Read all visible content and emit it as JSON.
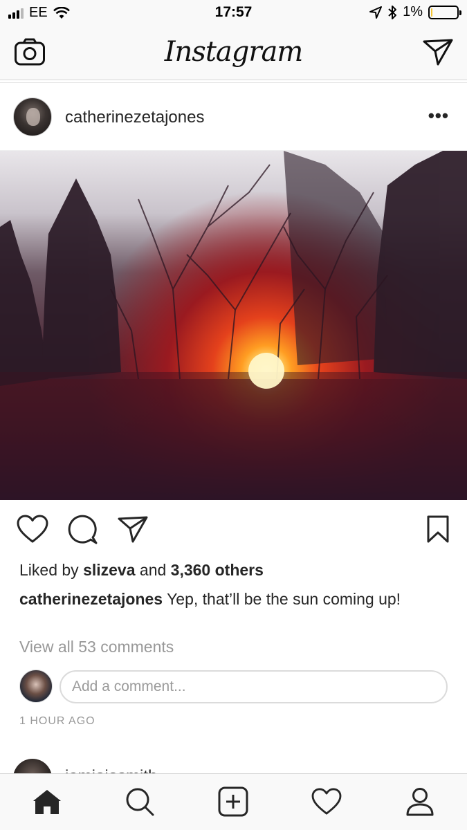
{
  "status_bar": {
    "carrier": "EE",
    "time": "17:57",
    "battery_percent": "1%",
    "battery_level": 0.05,
    "signal_bars_active": 3,
    "signal_bars_total": 4,
    "icons": [
      "wifi-icon",
      "location-arrow-icon",
      "bluetooth-icon",
      "battery-icon"
    ]
  },
  "header": {
    "logo": "Instagram",
    "left_icon": "camera-icon",
    "right_icon": "direct-message-icon"
  },
  "post": {
    "username": "catherinezetajones",
    "more_label": "•••",
    "image_description": "sunset",
    "actions": [
      "heart-icon",
      "comment-icon",
      "share-icon",
      "bookmark-icon"
    ],
    "likes_prefix": "Liked by",
    "liked_by_user": "slizeva",
    "likes_and": "and",
    "likes_others": "3,360 others",
    "caption_user": "catherinezetajones",
    "caption_text": "Yep, that’ll be the sun coming up!",
    "view_comments": "View all 53 comments",
    "comment_placeholder": "Add a comment...",
    "timestamp": "1 HOUR AGO"
  },
  "next_post": {
    "username_partial": "iamjojosmith"
  },
  "tab_bar": {
    "tabs": [
      "home-icon",
      "search-icon",
      "new-post-icon",
      "activity-icon",
      "profile-icon"
    ],
    "active": "home-icon"
  },
  "colors": {
    "text": "#262626",
    "muted": "#999999",
    "bar_bg": "#f9f9f9",
    "sun": "#ffdc5a"
  }
}
